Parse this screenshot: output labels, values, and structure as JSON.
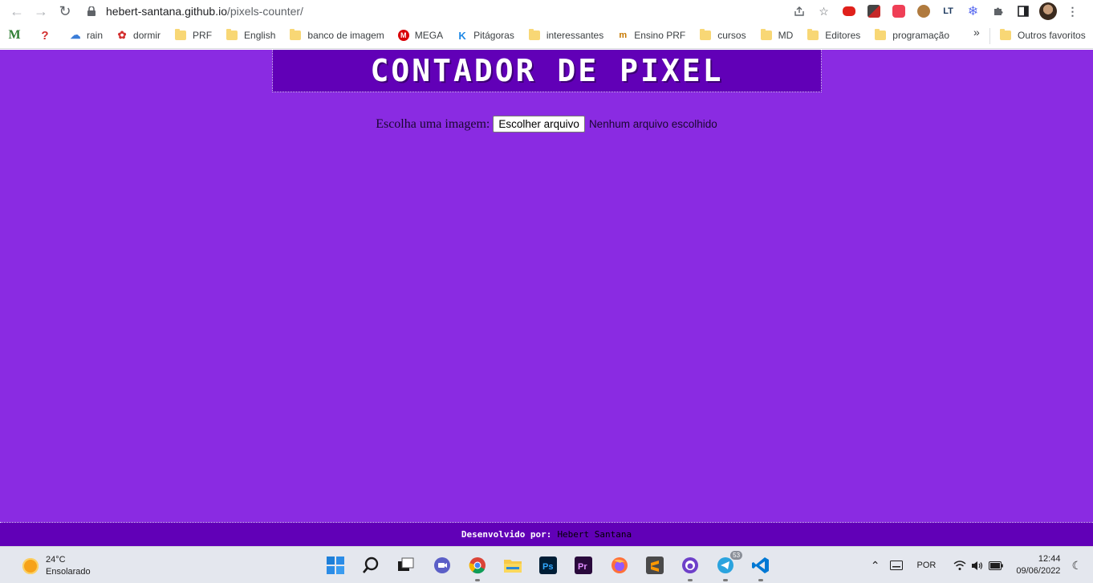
{
  "browser": {
    "url_host": "hebert-santana.github.io",
    "url_path": "/pixels-counter/",
    "bookmarks": [
      {
        "label": "",
        "icon": "mendeley-icon"
      },
      {
        "label": "",
        "icon": "question-icon"
      },
      {
        "label": "rain",
        "icon": "rain-icon"
      },
      {
        "label": "dormir",
        "icon": "sleep-icon"
      },
      {
        "label": "PRF",
        "icon": "folder-icon"
      },
      {
        "label": "English",
        "icon": "folder-icon"
      },
      {
        "label": "banco de imagem",
        "icon": "folder-icon"
      },
      {
        "label": "MEGA",
        "icon": "mega-icon"
      },
      {
        "label": "Pitágoras",
        "icon": "kroton-icon"
      },
      {
        "label": "interessantes",
        "icon": "folder-icon"
      },
      {
        "label": "Ensino PRF",
        "icon": "ensino-icon"
      },
      {
        "label": "cursos",
        "icon": "folder-icon"
      },
      {
        "label": "MD",
        "icon": "folder-icon"
      },
      {
        "label": "Editores",
        "icon": "folder-icon"
      },
      {
        "label": "programação",
        "icon": "folder-icon"
      }
    ],
    "more_bookmarks": "»",
    "other_favorites": "Outros favoritos"
  },
  "page": {
    "title": "CONTADOR DE PIXEL",
    "chooser_label": "Escolha uma imagem:",
    "file_button": "Escolher arquivo",
    "file_status": "Nenhum arquivo escolhido",
    "footer_label": "Desenvolvido por:",
    "footer_name": "Hebert Santana",
    "colors": {
      "background": "#8a2be2",
      "header": "#6100b7"
    }
  },
  "taskbar": {
    "weather_temp": "24°C",
    "weather_desc": "Ensolarado",
    "language": "POR",
    "time": "12:44",
    "date": "09/06/2022",
    "telegram_badge": "53",
    "apps": [
      "windows-start-icon",
      "search-icon",
      "task-view-icon",
      "teams-chat-icon",
      "chrome-icon",
      "file-explorer-icon",
      "photoshop-icon",
      "premiere-icon",
      "firefox-icon",
      "sublime-icon",
      "github-desktop-icon",
      "telegram-icon",
      "vscode-icon"
    ]
  }
}
